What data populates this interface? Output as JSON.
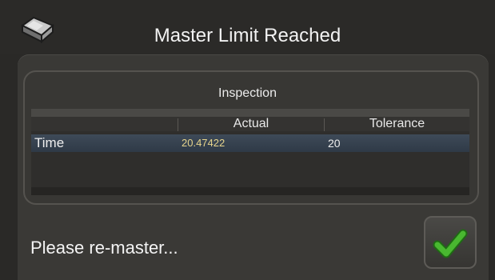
{
  "dialog": {
    "title": "Master Limit Reached",
    "status_message": "Please re-master...",
    "confirm_icon": "checkmark-icon",
    "app_icon": "gauge-device-icon"
  },
  "inspection": {
    "group_title": "Inspection",
    "columns": [
      "",
      "Actual",
      "Tolerance"
    ],
    "rows": [
      {
        "name": "Time",
        "actual": "20.47422",
        "tolerance": "20"
      }
    ]
  },
  "colors": {
    "actual_value": "#e6d48c",
    "row_selected": "#3e4a58",
    "check_green": "#3fae2a"
  }
}
